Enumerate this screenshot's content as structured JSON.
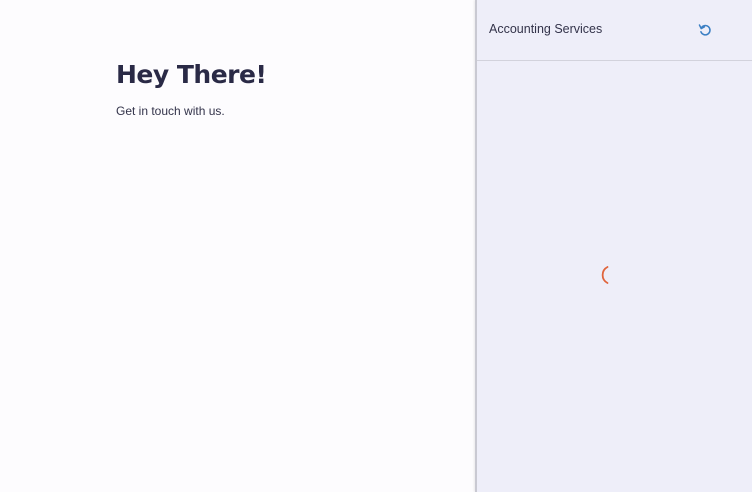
{
  "main": {
    "heading": "Hey There!",
    "subheading": "Get in touch with us."
  },
  "panel": {
    "title": "Accounting Services",
    "refresh_icon": "refresh-icon",
    "loading_icon": "loading-spinner-icon"
  },
  "colors": {
    "accent": "#3b7fc4",
    "spinner": "#e0643c",
    "panel_bg": "#eeeef9",
    "heading": "#2a2a46"
  }
}
